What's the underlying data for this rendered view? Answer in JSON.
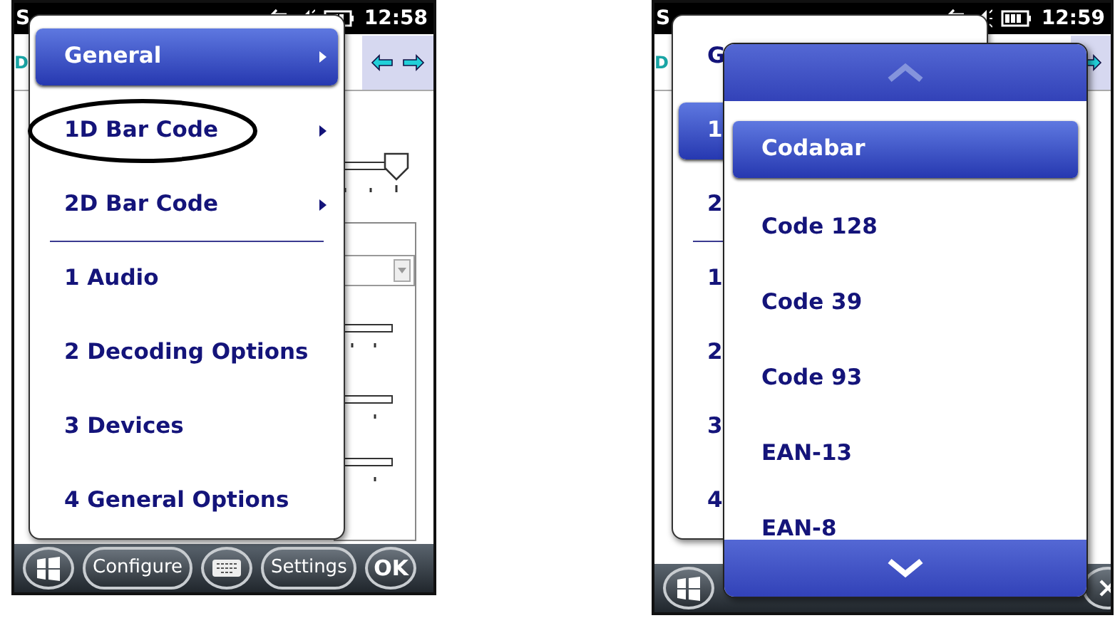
{
  "screens": [
    {
      "status_bar": {
        "title": "S",
        "time": "12:58"
      },
      "tab_fragment": "D",
      "toolbar_arrows": [
        {
          "kind": "back"
        },
        {
          "kind": "forward"
        }
      ],
      "menu": {
        "items": [
          {
            "kind": "submenu",
            "label": "General",
            "selected": true,
            "circled": false
          },
          {
            "kind": "submenu",
            "label": "1D Bar Code",
            "selected": false,
            "circled": true
          },
          {
            "kind": "submenu",
            "label": "2D Bar Code",
            "selected": false,
            "circled": false
          },
          {
            "kind": "separator"
          },
          {
            "kind": "item",
            "label": "1 Audio",
            "selected": false,
            "circled": false
          },
          {
            "kind": "item",
            "label": "2 Decoding Options",
            "selected": false,
            "circled": false
          },
          {
            "kind": "item",
            "label": "3 Devices",
            "selected": false,
            "circled": false
          },
          {
            "kind": "item",
            "label": "4 General Options",
            "selected": false,
            "circled": false
          }
        ]
      },
      "taskbar": {
        "buttons": [
          {
            "kind": "start"
          },
          {
            "kind": "pill",
            "label": "Configure"
          },
          {
            "kind": "keyboard"
          },
          {
            "kind": "pill",
            "label": "Settings"
          },
          {
            "kind": "round",
            "label": "OK"
          }
        ]
      }
    },
    {
      "status_bar": {
        "title": "S",
        "time": "12:59"
      },
      "tab_fragment": "D",
      "toolbar_arrows": [
        {
          "kind": "forward"
        }
      ],
      "menu": {
        "items": [
          {
            "kind": "item",
            "label": "G",
            "selected": false,
            "circled": false
          },
          {
            "kind": "item",
            "label": "1",
            "selected": true,
            "circled": false
          },
          {
            "kind": "item",
            "label": "2",
            "selected": false,
            "circled": false
          },
          {
            "kind": "separator"
          },
          {
            "kind": "item",
            "label": "1",
            "selected": false,
            "circled": false
          },
          {
            "kind": "item",
            "label": "2",
            "selected": false,
            "circled": false
          },
          {
            "kind": "item",
            "label": "3",
            "selected": false,
            "circled": false
          },
          {
            "kind": "item",
            "label": "4",
            "selected": false,
            "circled": false
          }
        ]
      },
      "popup": {
        "items": [
          {
            "label": "Codabar",
            "selected": true
          },
          {
            "label": "Code 128",
            "selected": false
          },
          {
            "label": "Code 39",
            "selected": false
          },
          {
            "label": "Code 93",
            "selected": false
          },
          {
            "label": "EAN-13",
            "selected": false
          },
          {
            "label": "EAN-8",
            "selected": false
          }
        ]
      },
      "taskbar": {
        "buttons": [
          {
            "kind": "start"
          },
          {
            "kind": "close"
          }
        ]
      }
    }
  ]
}
